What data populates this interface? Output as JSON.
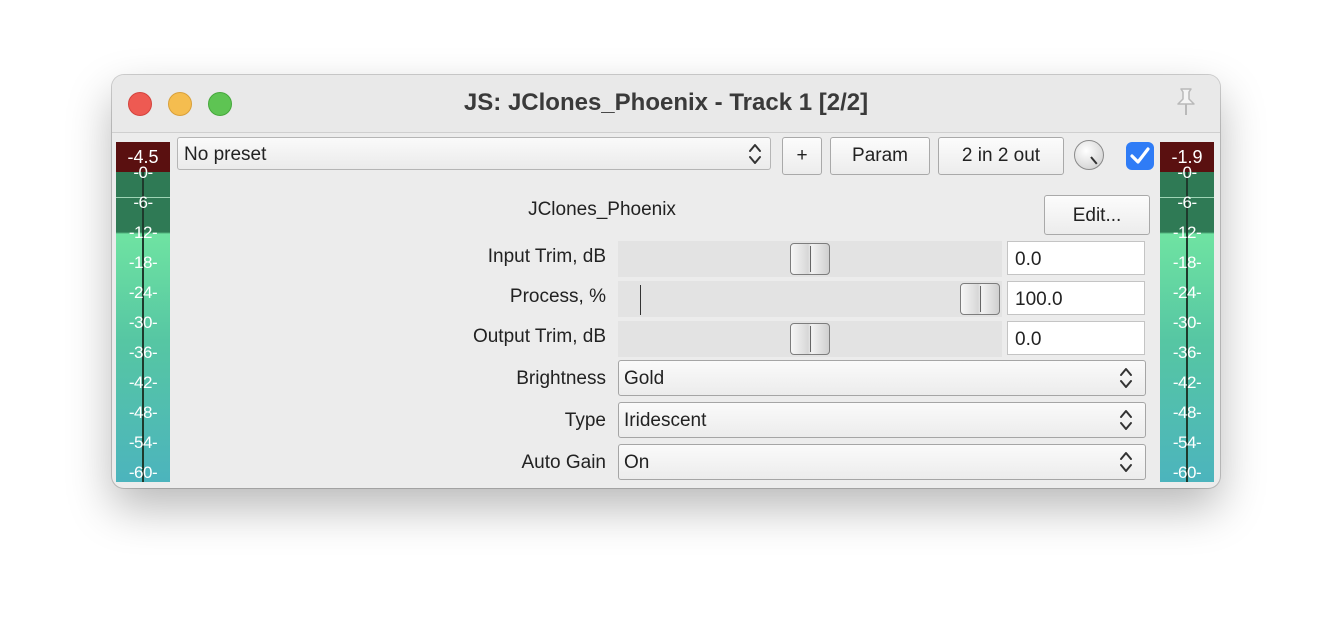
{
  "window": {
    "title": "JS: JClones_Phoenix - Track 1 [2/2]"
  },
  "toolbar": {
    "preset": "No preset",
    "add_label": "+",
    "param_label": "Param",
    "io_label": "2 in 2 out",
    "bypass_checked": true
  },
  "meters": {
    "left": {
      "peak": "-4.5",
      "ticks": [
        "-0-",
        "-6-",
        "-12-",
        "-18-",
        "-24-",
        "-30-",
        "-36-",
        "-42-",
        "-48-",
        "-54-",
        "-60-"
      ]
    },
    "right": {
      "peak": "-1.9",
      "ticks": [
        "-0-",
        "-6-",
        "-12-",
        "-18-",
        "-24-",
        "-30-",
        "-36-",
        "-42-",
        "-48-",
        "-54-",
        "-60-"
      ]
    }
  },
  "plugin": {
    "name": "JClones_Phoenix",
    "edit_label": "Edit...",
    "sliders": [
      {
        "label": "Input Trim, dB",
        "value": "0.0",
        "fraction": 0.5
      },
      {
        "label": "Process, %",
        "value": "100.0",
        "fraction": 1.0
      },
      {
        "label": "Output Trim, dB",
        "value": "0.0",
        "fraction": 0.5
      }
    ],
    "selects": [
      {
        "label": "Brightness",
        "value": "Gold"
      },
      {
        "label": "Type",
        "value": "Iridescent"
      },
      {
        "label": "Auto Gain",
        "value": "On"
      }
    ]
  }
}
